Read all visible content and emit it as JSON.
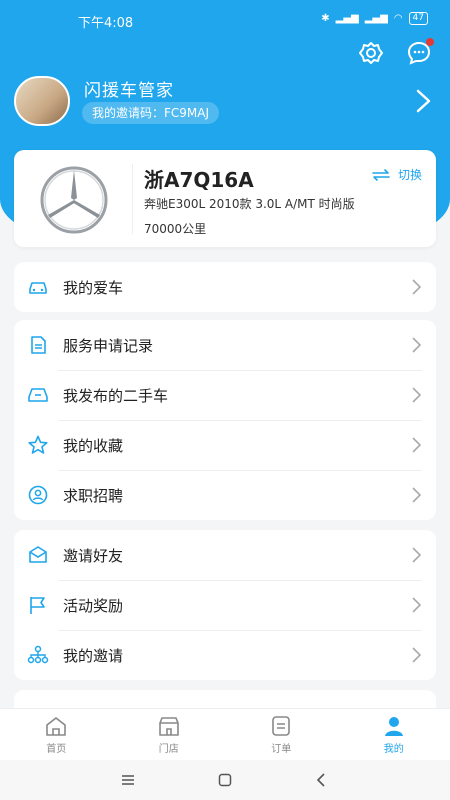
{
  "status": {
    "time": "下午4:08",
    "battery": "47"
  },
  "profile": {
    "name": "闪援车管家",
    "invite_code": "我的邀请码：FC9MAJ"
  },
  "car": {
    "plate": "浙A7Q16A",
    "switch_label": "切换",
    "model": "奔驰E300L 2010款 3.0L A/MT 时尚版",
    "mileage": "70000公里"
  },
  "groups": [
    {
      "items": [
        {
          "label": "我的爱车",
          "icon": "car-icon"
        }
      ]
    },
    {
      "items": [
        {
          "label": "服务申请记录",
          "icon": "document-icon"
        },
        {
          "label": "我发布的二手车",
          "icon": "used-car-icon"
        },
        {
          "label": "我的收藏",
          "icon": "star-icon"
        },
        {
          "label": "求职招聘",
          "icon": "person-icon"
        }
      ]
    },
    {
      "items": [
        {
          "label": "邀请好友",
          "icon": "mail-icon"
        },
        {
          "label": "活动奖励",
          "icon": "flag-icon"
        },
        {
          "label": "我的邀请",
          "icon": "network-icon"
        }
      ]
    }
  ],
  "bottom_nav": [
    {
      "label": "首页",
      "icon": "home-icon"
    },
    {
      "label": "门店",
      "icon": "store-icon"
    },
    {
      "label": "订单",
      "icon": "order-icon"
    },
    {
      "label": "我的",
      "icon": "user-icon",
      "active": true
    }
  ],
  "colors": {
    "accent": "#1fa6ec",
    "background": "#f4f5f7"
  }
}
